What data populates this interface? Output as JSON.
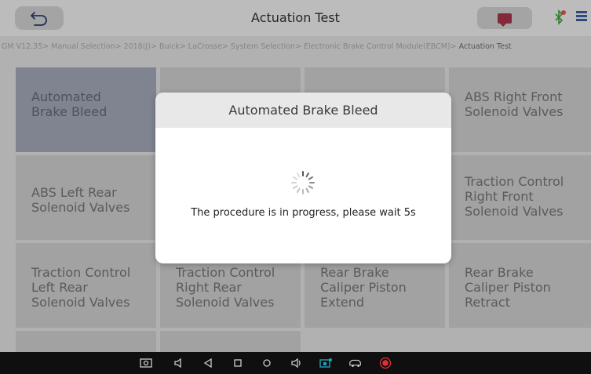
{
  "header": {
    "title": "Actuation Test"
  },
  "breadcrumb": {
    "path": "GM V12.35> Manual Selection> 2018(J)> Buick> LaCrosse> System Selection> Electronic Brake Control Module(EBCM)> ",
    "current": "Actuation Test"
  },
  "tiles": [
    {
      "l1": "Automated",
      "l2": "Brake Bleed",
      "l3": ""
    },
    {
      "l1": "ABS Right Front",
      "l2": "Solenoid Valves",
      "l3": ""
    },
    {
      "l1": "ABS Left Rear",
      "l2": "Solenoid Valves",
      "l3": ""
    },
    {
      "l1": "Traction Control",
      "l2": "Right Front",
      "l3": "Solenoid Valves"
    },
    {
      "l1": "Traction Control",
      "l2": "Left Rear",
      "l3": "Solenoid Valves"
    },
    {
      "l1": "Traction Control",
      "l2": "Right Rear",
      "l3": "Solenoid Valves"
    },
    {
      "l1": "Rear Brake",
      "l2": "Caliper Piston",
      "l3": "Extend"
    },
    {
      "l1": "Rear Brake",
      "l2": "Caliper Piston",
      "l3": "Retract"
    }
  ],
  "dialog": {
    "title": "Automated Brake Bleed",
    "message": "The procedure is in progress, please wait 5s"
  },
  "colors": {
    "accent_green": "#3a9a3a",
    "message_icon": "#a0324a",
    "record_red": "#e0303a",
    "teal_icon": "#1fa3b8"
  },
  "icons": {
    "back": "back-arrow-icon",
    "message": "message-icon",
    "bluetooth": "bluetooth-icon",
    "network": "network-icon",
    "spinner": "loading-spinner-icon"
  }
}
